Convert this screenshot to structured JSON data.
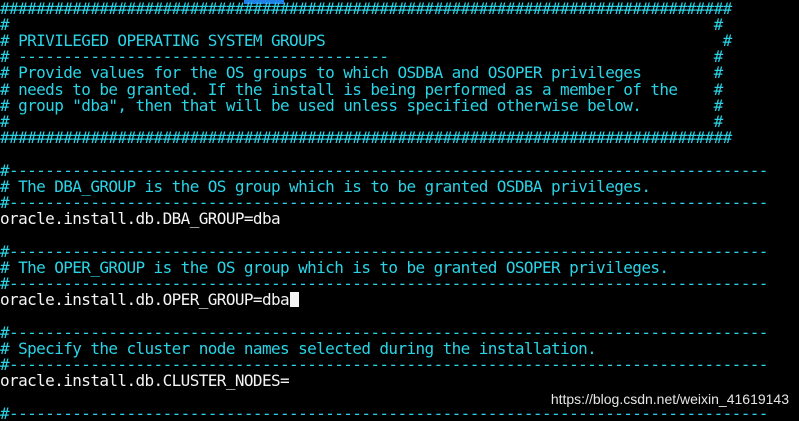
{
  "terminal": {
    "background_color": "#000000",
    "comment_color": "#2ad4e6",
    "text_color": "#f4f4f4",
    "lines": [
      "#################################################################################",
      "#                                                                              #",
      "# PRIVILEGED OPERATING SYSTEM GROUPS                                            #",
      "# -----------------------------------------                                    #",
      "# Provide values for the OS groups to which OSDBA and OSOPER privileges        #",
      "# needs to be granted. If the install is being performed as a member of the    #",
      "# group \"dba\", then that will be used unless specified otherwise below.        #",
      "#                                                                              #",
      "#################################################################################",
      "",
      "#------------------------------------------------------------------------------------",
      "# The DBA_GROUP is the OS group which is to be granted OSDBA privileges.",
      "#------------------------------------------------------------------------------------",
      "oracle.install.db.DBA_GROUP=dba",
      "",
      "#------------------------------------------------------------------------------------",
      "# The OPER_GROUP is the OS group which is to be granted OSOPER privileges.",
      "#------------------------------------------------------------------------------------",
      "oracle.install.db.OPER_GROUP=dba",
      "",
      "#------------------------------------------------------------------------------------",
      "# Specify the cluster node names selected during the installation.",
      "#------------------------------------------------------------------------------------",
      "oracle.install.db.CLUSTER_NODES=",
      "",
      "#------------------------------------------------------------------------------------"
    ],
    "cursor_line": 18
  },
  "watermark": {
    "text": "https://blog.csdn.net/weixin_41619143"
  }
}
